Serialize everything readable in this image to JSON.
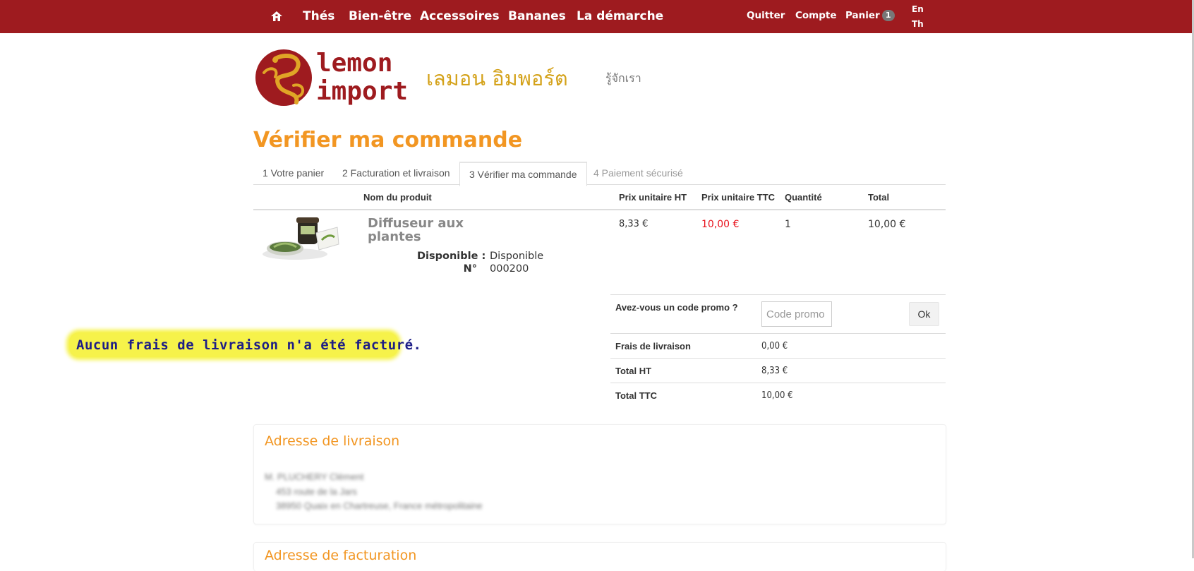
{
  "nav": {
    "home_icon": "home-icon",
    "links": [
      "Thés",
      "Bien-être",
      "Accessoires",
      "Bananes",
      "La démarche"
    ],
    "quit": "Quitter",
    "account": "Compte",
    "cart": "Panier",
    "cart_count": "1",
    "lang_en": "En",
    "lang_th": "Th"
  },
  "header": {
    "logo_line1": "lemon",
    "logo_line2": "import",
    "thai_name": "เลมอน อิมพอร์ต",
    "about": "รู้จักเรา"
  },
  "page_title": "Vérifier ma commande",
  "steps": [
    {
      "label": "1 Votre panier"
    },
    {
      "label": "2 Facturation et livraison"
    },
    {
      "label": "3 Vérifier ma commande"
    },
    {
      "label": "4 Paiement sécurisé"
    }
  ],
  "table": {
    "headers": {
      "name": "Nom du produit",
      "unit_ht": "Prix unitaire HT",
      "unit_ttc": "Prix unitaire TTC",
      "qty": "Quantité",
      "total": "Total"
    },
    "rows": [
      {
        "name_line1": "Diffuseur aux",
        "name_line2": "plantes",
        "avail_label": "Disponible :",
        "avail_value": "Disponible",
        "ref_label": "N°",
        "ref_value": "000200",
        "unit_ht": "8,33 €",
        "unit_ttc": "10,00 €",
        "qty": "1",
        "total": "10,00 €"
      }
    ]
  },
  "promo": {
    "question": "Avez-vous un code promo ?",
    "placeholder": "Code promo",
    "button": "Ok"
  },
  "totals": [
    {
      "label": "Frais de livraison",
      "value": "0,00 €"
    },
    {
      "label": "Total HT",
      "value": "8,33 €"
    },
    {
      "label": "Total TTC",
      "value": "10,00 €"
    }
  ],
  "annotation": "Aucun frais de livraison n'a été facturé.",
  "shipping_address": {
    "title": "Adresse de livraison",
    "line1": "M. PLUCHERY Clément",
    "line2": "453 route de la Jars",
    "line3": "38950 Quaix en Chartreuse, France métropolitaine"
  },
  "billing_address": {
    "title": "Adresse de facturation"
  },
  "colors": {
    "nav_bg": "#9e1b1f",
    "accent_orange": "#f29622",
    "price_red": "#e8131d",
    "highlight": "#f6f24a"
  }
}
